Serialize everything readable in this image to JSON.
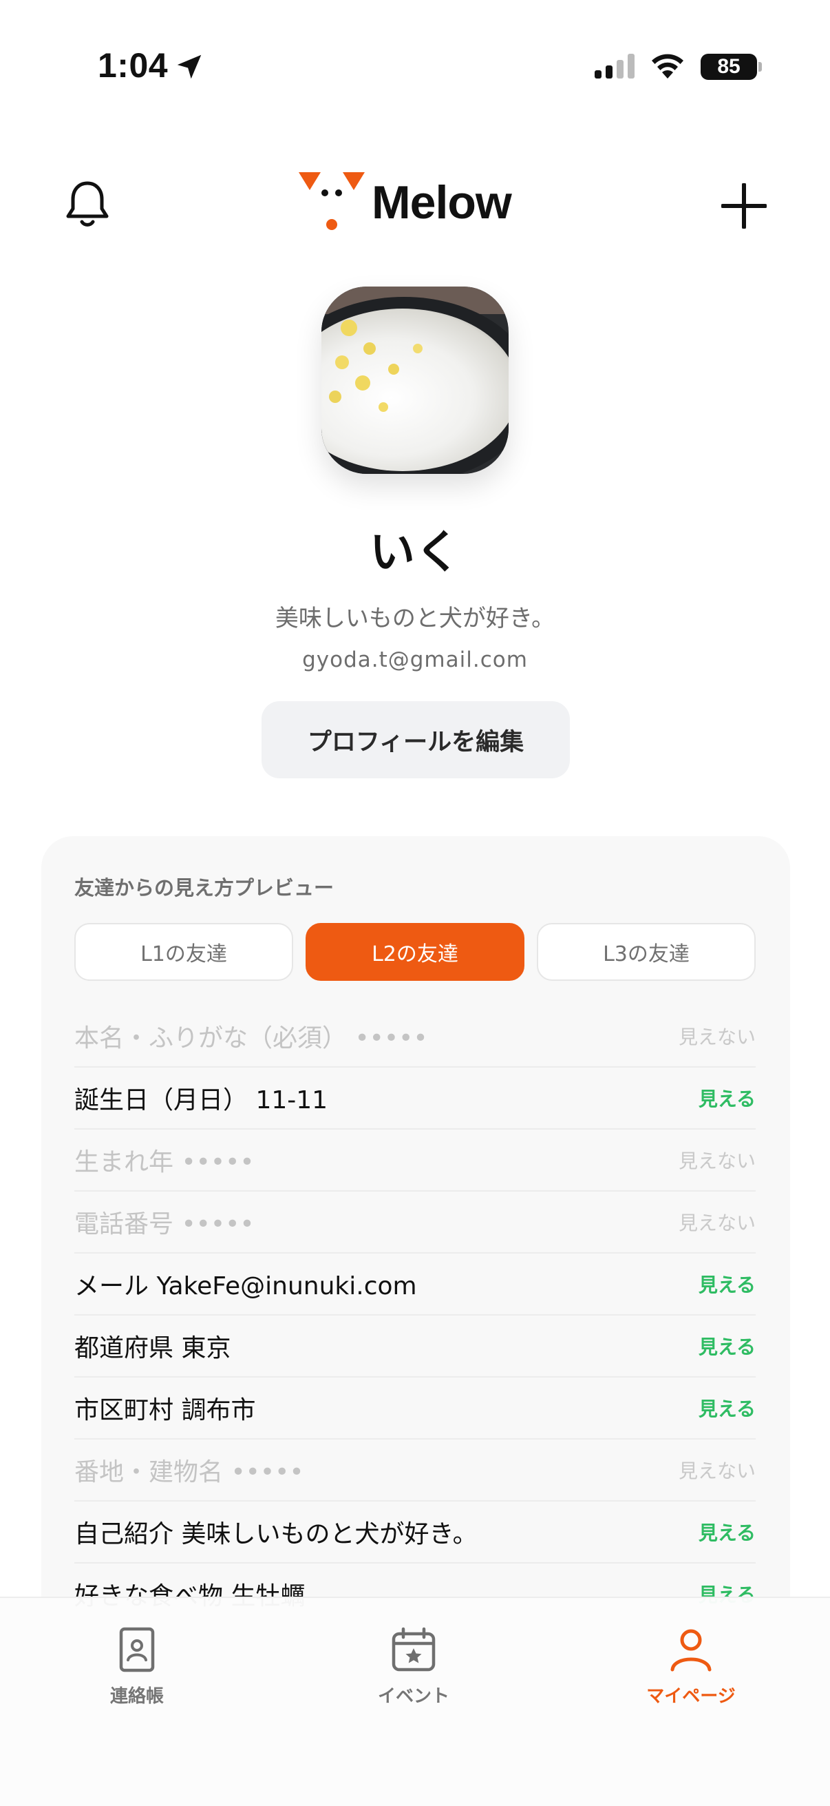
{
  "status_bar": {
    "time": "1:04",
    "battery": "85",
    "icons": [
      "location-arrow-icon",
      "cellular-signal-icon",
      "wifi-icon",
      "battery-icon"
    ]
  },
  "header": {
    "logo_text": "Melow",
    "icons": [
      "bell-icon",
      "melow-logo-icon",
      "plus-icon"
    ]
  },
  "profile": {
    "name": "いく",
    "bio": "美味しいものと犬が好き。",
    "email": "gyoda.t@gmail.com",
    "edit_button": "プロフィールを編集"
  },
  "preview": {
    "title": "友達からの見え方プレビュー",
    "segments": [
      {
        "label": "L1の友達",
        "selected": false
      },
      {
        "label": "L2の友達",
        "selected": true
      },
      {
        "label": "L3の友達",
        "selected": false
      }
    ],
    "rows": [
      {
        "text": "本名・ふりがな（必須） •••••",
        "status": "見えない",
        "visible": false
      },
      {
        "text": "誕生日（月日） 11-11",
        "status": "見える",
        "visible": true
      },
      {
        "text": "生まれ年 •••••",
        "status": "見えない",
        "visible": false
      },
      {
        "text": "電話番号 •••••",
        "status": "見えない",
        "visible": false
      },
      {
        "text": "メール YakeFe@inunuki.com",
        "status": "見える",
        "visible": true
      },
      {
        "text": "都道府県 東京",
        "status": "見える",
        "visible": true
      },
      {
        "text": "市区町村 調布市",
        "status": "見える",
        "visible": true
      },
      {
        "text": "番地・建物名 •••••",
        "status": "見えない",
        "visible": false
      },
      {
        "text": "自己紹介 美味しいものと犬が好き。",
        "status": "見える",
        "visible": true
      },
      {
        "text": "好きな食べ物 生牡蠣",
        "status": "見える",
        "visible": true
      }
    ]
  },
  "tabbar": {
    "tabs": [
      {
        "label": "連絡帳",
        "icon": "contact-book-icon",
        "active": false
      },
      {
        "label": "イベント",
        "icon": "calendar-star-icon",
        "active": false
      },
      {
        "label": "マイページ",
        "icon": "person-icon",
        "active": true
      }
    ]
  },
  "colors": {
    "accent": "#ee5a12",
    "visible_green": "#2fbc63",
    "muted_text": "#6d6d6d"
  }
}
